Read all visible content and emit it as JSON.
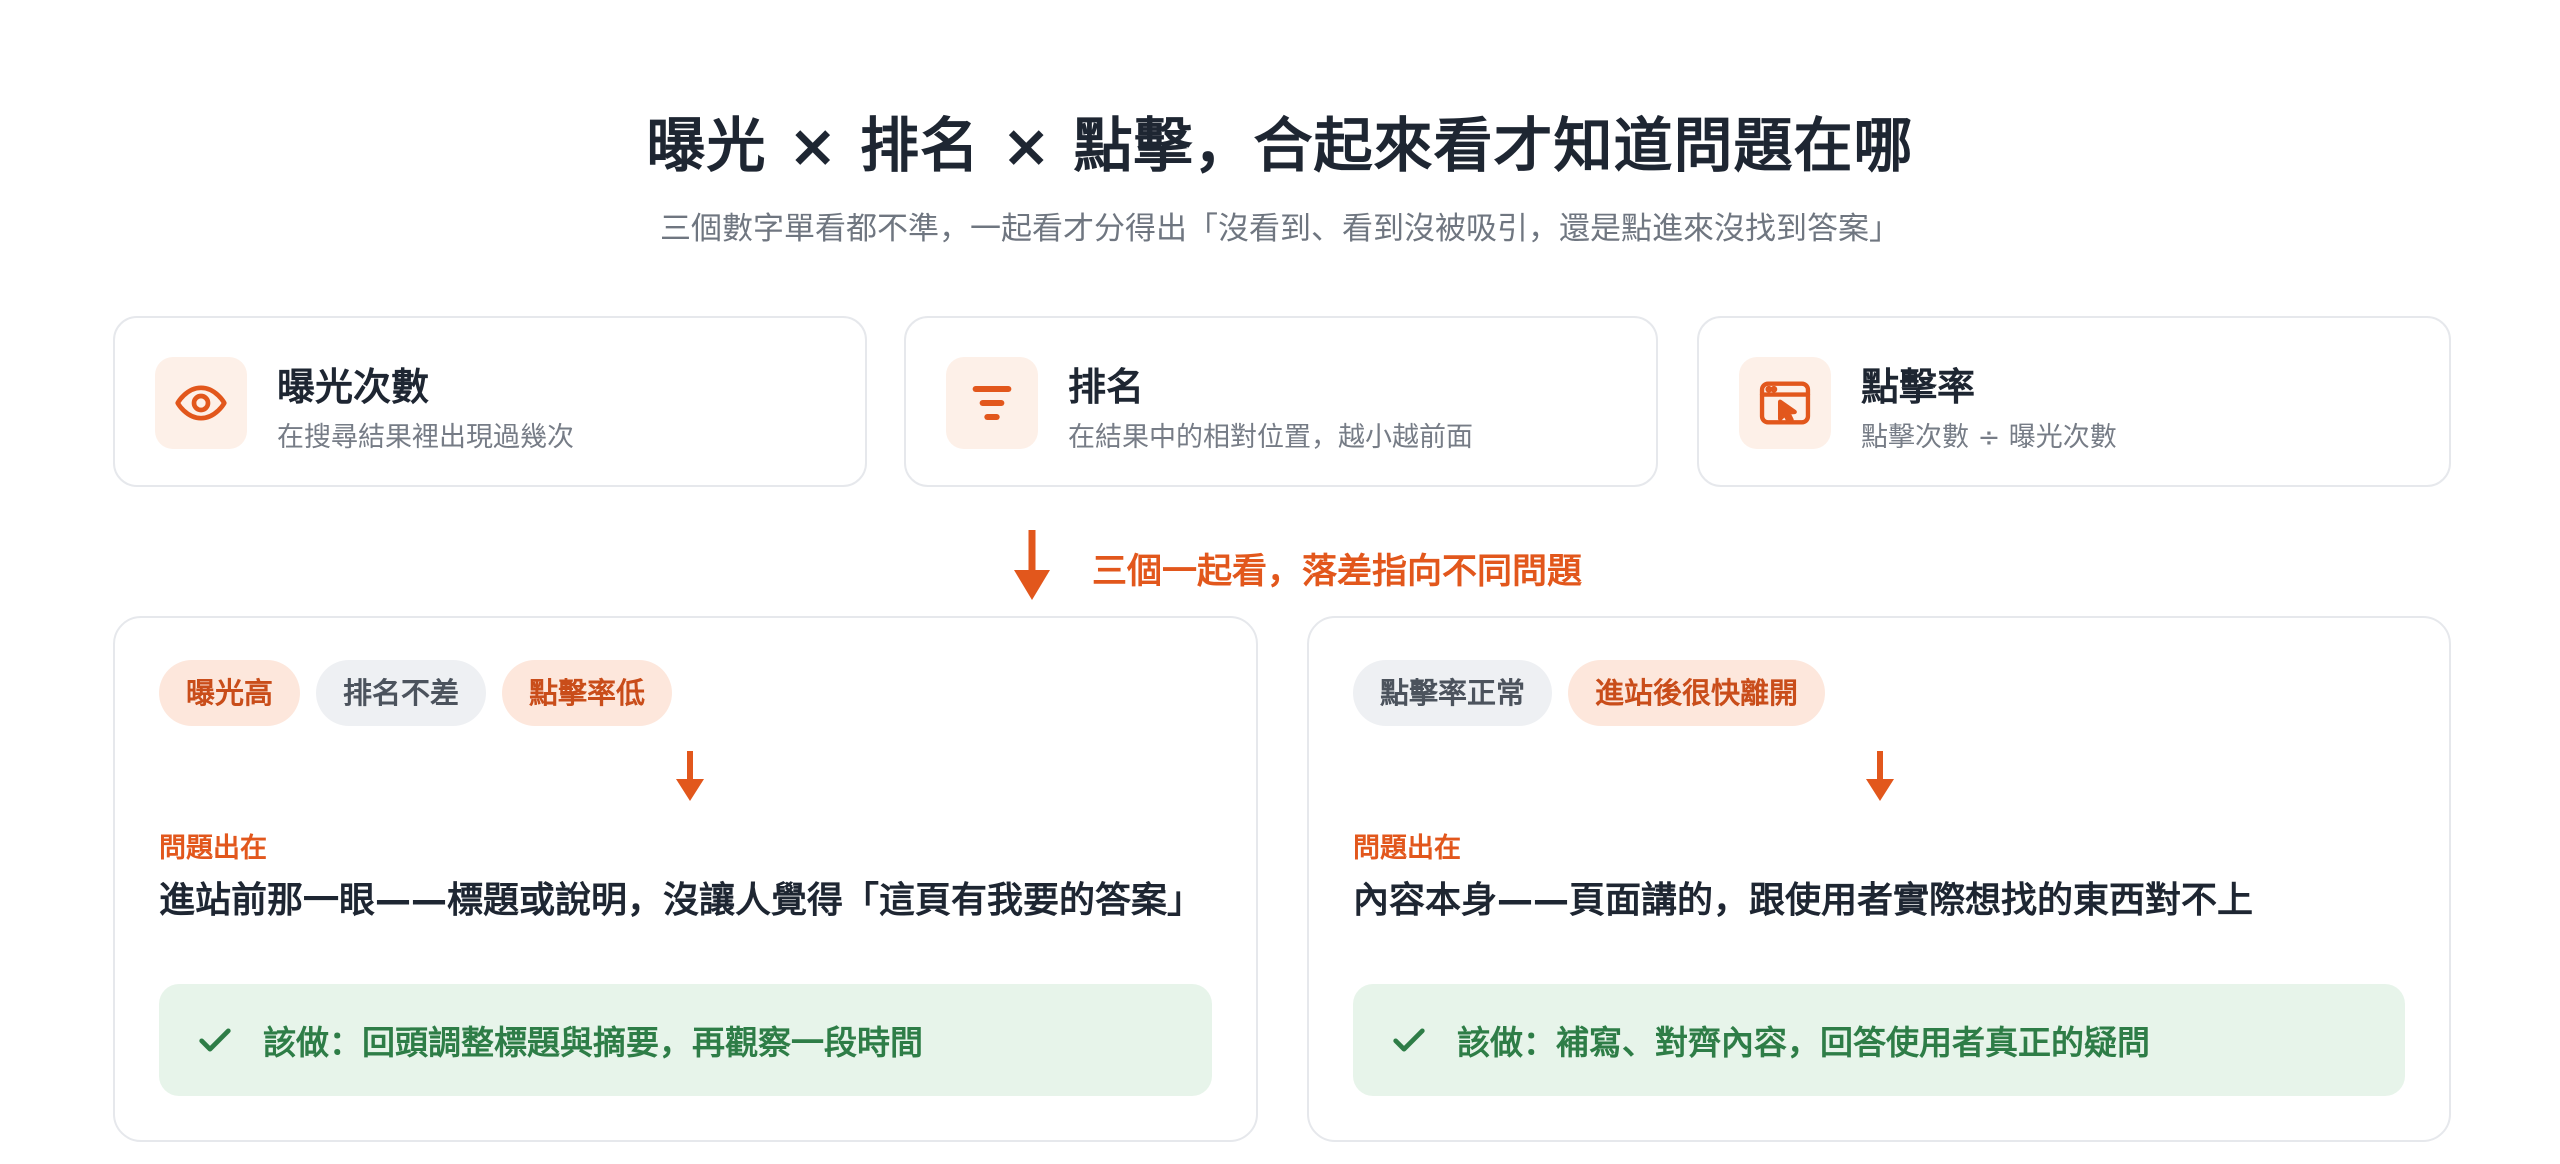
{
  "header": {
    "title": "曝光 × 排名 × 點擊，合起來看才知道問題在哪",
    "subtitle": "三個數字單看都不準，一起看才分得出「沒看到、看到沒被吸引，還是點進來沒找到答案」"
  },
  "metrics": [
    {
      "icon": "eye-icon",
      "title": "曝光次數",
      "desc": "在搜尋結果裡出現過幾次"
    },
    {
      "icon": "rank-bars-icon",
      "title": "排名",
      "desc": "在結果中的相對位置，越小越前面"
    },
    {
      "icon": "click-window-icon",
      "title": "點擊率",
      "desc": "點擊次數 ÷ 曝光次數"
    }
  ],
  "connector_label": "三個一起看，落差指向不同問題",
  "cases": [
    {
      "tags": [
        {
          "label": "曝光高",
          "style": "hot"
        },
        {
          "label": "排名不差",
          "style": "neutral"
        },
        {
          "label": "點擊率低",
          "style": "hot"
        }
      ],
      "problem_label": "問題出在",
      "problem": "進站前那一眼——標題或說明，沒讓人覺得「這頁有我要的答案」",
      "action": "該做：回頭調整標題與摘要，再觀察一段時間"
    },
    {
      "tags": [
        {
          "label": "點擊率正常",
          "style": "neutral"
        },
        {
          "label": "進站後很快離開",
          "style": "hot"
        }
      ],
      "problem_label": "問題出在",
      "problem": "內容本身——頁面講的，跟使用者實際想找的東西對不上",
      "action": "該做：補寫、對齊內容，回答使用者真正的疑問"
    }
  ],
  "colors": {
    "accent": "#e2571c",
    "accent_soft": "#fdf0e8",
    "tag_hot_bg": "#fde7dc",
    "tag_neutral_bg": "#eef0f3",
    "success_bg": "#e7f4ea",
    "success_text": "#2e7d47",
    "border": "#e6e8ec"
  }
}
